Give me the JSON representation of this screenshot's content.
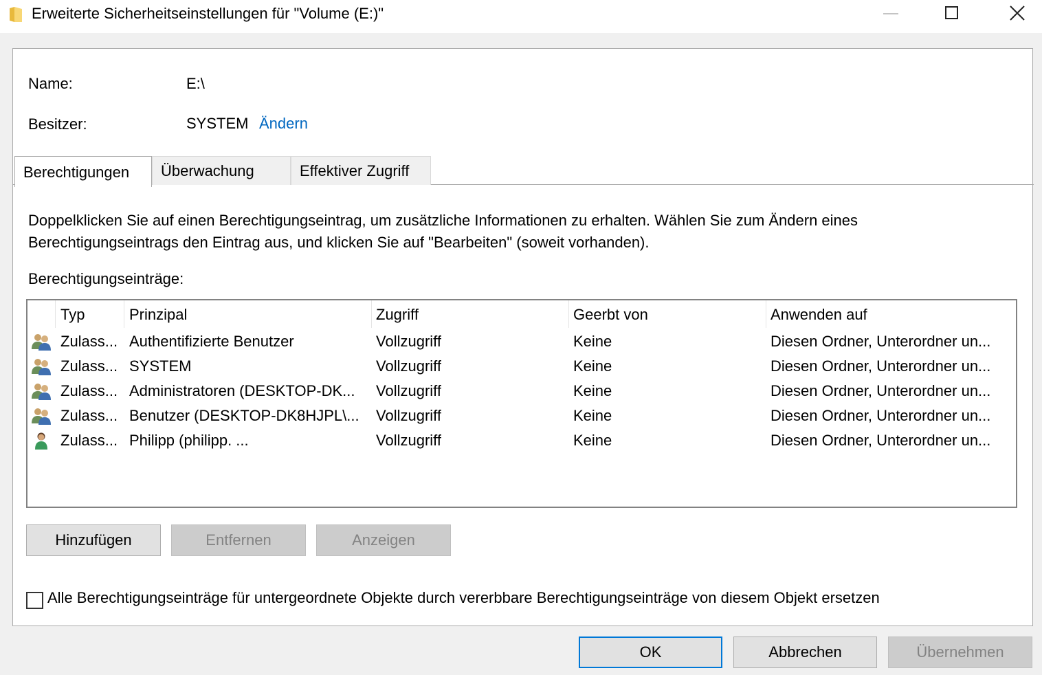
{
  "window": {
    "title": "Erweiterte Sicherheitseinstellungen für \"Volume (E:)\"",
    "accent": "#0078d7"
  },
  "info": {
    "name_label": "Name:",
    "name_value": "E:\\",
    "owner_label": "Besitzer:",
    "owner_value": "SYSTEM",
    "owner_change_link": "Ändern"
  },
  "tabs": [
    {
      "label": "Berechtigungen",
      "active": true
    },
    {
      "label": "Überwachung",
      "active": false
    },
    {
      "label": "Effektiver Zugriff",
      "active": false
    }
  ],
  "permissions": {
    "description": "Doppelklicken Sie auf einen Berechtigungseintrag, um zusätzliche Informationen zu erhalten. Wählen Sie zum Ändern eines Berechtigungseintrags den Eintrag aus, und klicken Sie auf \"Bearbeiten\" (soweit vorhanden).",
    "entries_label": "Berechtigungseinträge:",
    "columns": [
      "Typ",
      "Prinzipal",
      "Zugriff",
      "Geerbt von",
      "Anwenden auf"
    ],
    "rows": [
      {
        "icon": "user-group-icon",
        "type": "Zulass...",
        "principal": "Authentifizierte Benutzer",
        "access": "Vollzugriff",
        "inherited": "Keine",
        "applies": "Diesen Ordner, Unterordner un..."
      },
      {
        "icon": "user-group-icon",
        "type": "Zulass...",
        "principal": "SYSTEM",
        "access": "Vollzugriff",
        "inherited": "Keine",
        "applies": "Diesen Ordner, Unterordner un..."
      },
      {
        "icon": "user-group-icon",
        "type": "Zulass...",
        "principal": "Administratoren (DESKTOP-DK...",
        "access": "Vollzugriff",
        "inherited": "Keine",
        "applies": "Diesen Ordner, Unterordner un..."
      },
      {
        "icon": "user-group-icon",
        "type": "Zulass...",
        "principal": "Benutzer (DESKTOP-DK8HJPL\\...",
        "access": "Vollzugriff",
        "inherited": "Keine",
        "applies": "Diesen Ordner, Unterordner un..."
      },
      {
        "icon": "user-icon",
        "type": "Zulass...",
        "principal": "Philipp         (philipp.          ...",
        "access": "Vollzugriff",
        "inherited": "Keine",
        "applies": "Diesen Ordner, Unterordner un..."
      }
    ]
  },
  "buttons": {
    "add": "Hinzufügen",
    "remove": "Entfernen",
    "view": "Anzeigen"
  },
  "replace_checkbox": {
    "label": "Alle Berechtigungseinträge für untergeordnete Objekte durch vererbbare Berechtigungseinträge von diesem Objekt ersetzen",
    "checked": false
  },
  "footer": {
    "ok": "OK",
    "cancel": "Abbrechen",
    "apply": "Übernehmen"
  }
}
